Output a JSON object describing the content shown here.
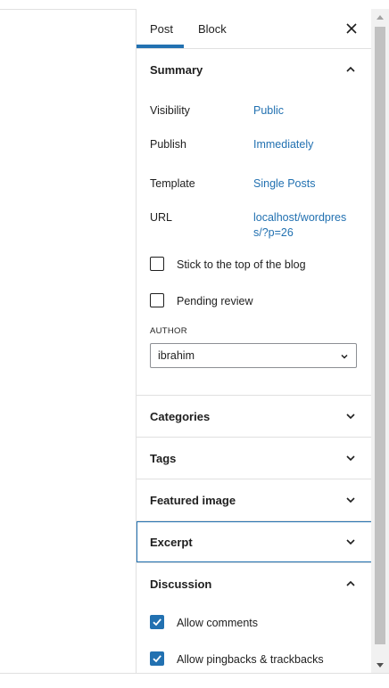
{
  "tabs": {
    "post": "Post",
    "block": "Block",
    "close_icon": "close-icon",
    "active": "post"
  },
  "summary": {
    "title": "Summary",
    "expanded": true,
    "rows": [
      {
        "label": "Visibility",
        "value": "Public"
      },
      {
        "label": "Publish",
        "value": "Immediately"
      },
      {
        "label": "Template",
        "value": "Single Posts"
      },
      {
        "label": "URL",
        "value_line1": "localhost/wordpres",
        "value_line2": "s/?p=26"
      }
    ],
    "sticky_label": "Stick to the top of the blog",
    "sticky_checked": false,
    "pending_label": "Pending review",
    "pending_checked": false,
    "author_label": "AUTHOR",
    "author_value": "ibrahim"
  },
  "panels": {
    "categories": "Categories",
    "tags": "Tags",
    "featured_image": "Featured image",
    "excerpt": "Excerpt"
  },
  "discussion": {
    "title": "Discussion",
    "expanded": true,
    "allow_comments_label": "Allow comments",
    "allow_comments_checked": true,
    "allow_pingbacks_label": "Allow pingbacks & trackbacks",
    "allow_pingbacks_checked": true
  },
  "colors": {
    "accent": "#2271b1",
    "border": "#e0e0e0",
    "text": "#1e1e1e"
  }
}
